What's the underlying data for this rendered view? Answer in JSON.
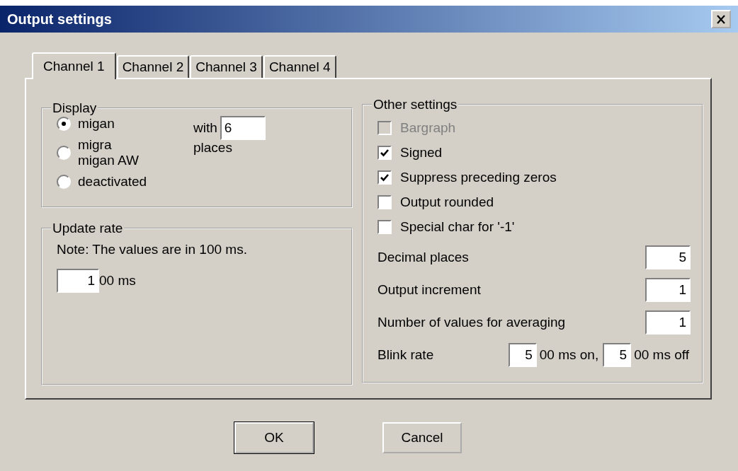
{
  "window": {
    "title": "Output settings"
  },
  "tabs": [
    {
      "label": "Channel 1",
      "selected": true
    },
    {
      "label": "Channel 2",
      "selected": false
    },
    {
      "label": "Channel 3",
      "selected": false
    },
    {
      "label": "Channel 4",
      "selected": false
    }
  ],
  "display": {
    "title": "Display",
    "options": [
      {
        "label": "migan",
        "selected": true
      },
      {
        "label": "migra\nmigan AW",
        "selected": false
      },
      {
        "label": "deactivated",
        "selected": false
      }
    ],
    "with_label": "with",
    "places_value": "6",
    "places_label": "places"
  },
  "update_rate": {
    "title": "Update rate",
    "note": "Note: The values are in 100 ms.",
    "value": "1",
    "unit": "00 ms"
  },
  "other_settings": {
    "title": "Other settings",
    "checks": [
      {
        "label": "Bargraph",
        "checked": false,
        "disabled": true
      },
      {
        "label": "Signed",
        "checked": true,
        "disabled": false
      },
      {
        "label": "Suppress preceding zeros",
        "checked": true,
        "disabled": false
      },
      {
        "label": "Output rounded",
        "checked": false,
        "disabled": false
      },
      {
        "label": "Special char for '-1'",
        "checked": false,
        "disabled": false
      }
    ],
    "fields": [
      {
        "label": "Decimal places",
        "value": "5"
      },
      {
        "label": "Output increment",
        "value": "1"
      },
      {
        "label": "Number of values for averaging",
        "value": "1"
      }
    ],
    "blink": {
      "label": "Blink rate",
      "on_value": "5",
      "on_unit": "00 ms on,",
      "off_value": "5",
      "off_unit": "00 ms off"
    }
  },
  "buttons": [
    "OK",
    "Cancel"
  ]
}
